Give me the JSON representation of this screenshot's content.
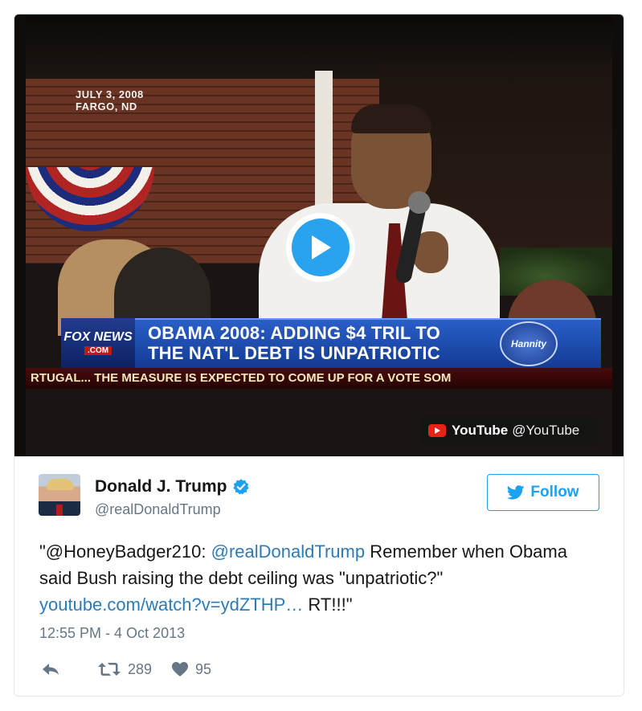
{
  "video": {
    "dateline_line1": "JULY 3, 2008",
    "dateline_line2": "FARGO, ND",
    "network_logo": "FOX NEWS",
    "network_logo_suffix": ".COM",
    "headline_line1": "OBAMA 2008: ADDING $4 TRIL TO",
    "headline_line2": "THE NAT'L DEBT IS UNPATRIOTIC",
    "show_logo": "Hannity",
    "ticker": "RTUGAL... THE MEASURE IS EXPECTED TO COME UP FOR A VOTE SOM",
    "source_name": "YouTube",
    "source_handle": "@YouTube",
    "play_icon": "play-icon"
  },
  "tweet": {
    "author_name": "Donald J. Trump",
    "author_handle": "@realDonaldTrump",
    "follow_label": "Follow",
    "text_part1": "\"@HoneyBadger210: ",
    "text_mention": "@realDonaldTrump",
    "text_part2": " Remember when Obama said Bush raising the debt ceiling was \"unpatriotic?\" ",
    "text_link": "youtube.com/watch?v=ydZTHP…",
    "text_part3": " RT!!!\"",
    "timestamp": "12:55 PM - 4 Oct 2013",
    "retweets": "289",
    "likes": "95"
  },
  "colors": {
    "accent": "#1da1f2",
    "link": "#2b7bb9",
    "muted": "#657786",
    "text": "#14171a",
    "youtube_red": "#e62117"
  },
  "icons": [
    "play-icon",
    "verified-badge-icon",
    "twitter-bird-icon",
    "reply-icon",
    "retweet-icon",
    "heart-icon",
    "youtube-logo-icon"
  ]
}
